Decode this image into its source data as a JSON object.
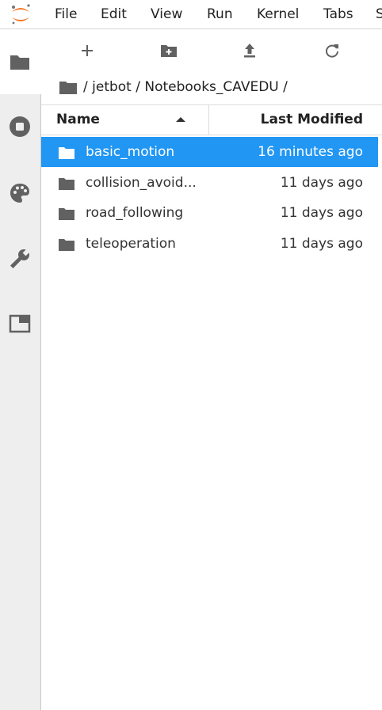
{
  "menubar": {
    "items": [
      "File",
      "Edit",
      "View",
      "Run",
      "Kernel",
      "Tabs",
      "S"
    ]
  },
  "colors": {
    "accent": "#2196f3",
    "logo": "#f37626",
    "icon": "#616161",
    "sidebar_bg": "#eeeeee"
  },
  "sidebar": {
    "icons": [
      "folder-icon",
      "stop-circle-icon",
      "palette-icon",
      "wrench-icon",
      "tab-window-icon"
    ]
  },
  "toolbar": {
    "icons": [
      "new-launcher-icon",
      "new-folder-icon",
      "upload-icon",
      "refresh-icon"
    ]
  },
  "breadcrumb": {
    "text": "/ jetbot / Notebooks_CAVEDU /"
  },
  "table": {
    "col_name": "Name",
    "col_modified": "Last Modified",
    "rows": [
      {
        "name": "basic_motion",
        "modified": "16 minutes ago",
        "selected": true
      },
      {
        "name": "collision_avoid...",
        "modified": "11 days ago",
        "selected": false
      },
      {
        "name": "road_following",
        "modified": "11 days ago",
        "selected": false
      },
      {
        "name": "teleoperation",
        "modified": "11 days ago",
        "selected": false
      }
    ]
  }
}
